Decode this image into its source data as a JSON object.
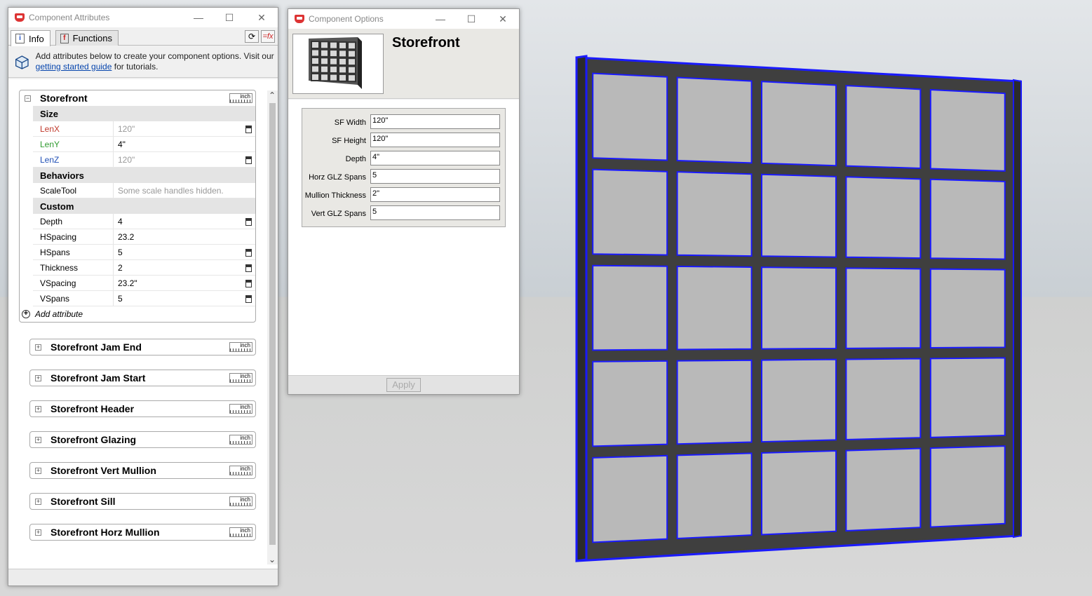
{
  "attrs_window": {
    "title": "Component Attributes",
    "tabs": [
      {
        "label": "Info",
        "active": true
      },
      {
        "label": "Functions",
        "active": false
      }
    ],
    "info_text_1": "Add attributes below to create your component options. Visit our ",
    "info_link": "getting started guide",
    "info_text_2": " for tutorials.",
    "unit_label": "inch",
    "main_group": {
      "name": "Storefront",
      "sections": [
        {
          "title": "Size",
          "rows": [
            {
              "key": "LenX",
              "value": "120\"",
              "key_color": "#c0392b",
              "value_grey": true,
              "calc": true
            },
            {
              "key": "LenY",
              "value": "4\"",
              "key_color": "#2e9a2e",
              "value_grey": false,
              "calc": false
            },
            {
              "key": "LenZ",
              "value": "120\"",
              "key_color": "#1f4fb5",
              "value_grey": true,
              "calc": true
            }
          ]
        },
        {
          "title": "Behaviors",
          "rows": [
            {
              "key": "ScaleTool",
              "value": "Some scale handles hidden.",
              "key_color": "#000000",
              "value_grey": true,
              "calc": false
            }
          ]
        },
        {
          "title": "Custom",
          "rows": [
            {
              "key": "Depth",
              "value": "4",
              "key_color": "#000000",
              "value_grey": false,
              "calc": true
            },
            {
              "key": "HSpacing",
              "value": "23.2",
              "key_color": "#000000",
              "value_grey": false,
              "calc": false
            },
            {
              "key": "HSpans",
              "value": "5",
              "key_color": "#000000",
              "value_grey": false,
              "calc": true
            },
            {
              "key": "Thickness",
              "value": "2",
              "key_color": "#000000",
              "value_grey": false,
              "calc": true
            },
            {
              "key": "VSpacing",
              "value": "23.2\"",
              "key_color": "#000000",
              "value_grey": false,
              "calc": true
            },
            {
              "key": "VSpans",
              "value": "5",
              "key_color": "#000000",
              "value_grey": false,
              "calc": true
            }
          ]
        }
      ],
      "add_attribute": "Add attribute"
    },
    "collapsed_groups": [
      "Storefront Jam End",
      "Storefront Jam Start",
      "Storefront Header",
      "Storefront Glazing",
      "Storefront Vert Mullion",
      "Storefront Sill",
      "Storefront Horz Mullion"
    ]
  },
  "options_window": {
    "title": "Component Options",
    "component_name": "Storefront",
    "fields": [
      {
        "label": "SF Width",
        "value": "120\""
      },
      {
        "label": "SF Height",
        "value": "120\""
      },
      {
        "label": "Depth",
        "value": "4\""
      },
      {
        "label": "Horz GLZ Spans",
        "value": "5"
      },
      {
        "label": "Mullion Thickness",
        "value": "2\""
      },
      {
        "label": "Vert GLZ Spans",
        "value": "5"
      }
    ],
    "apply_label": "Apply"
  },
  "colors": {
    "selection_blue": "#1a1aff",
    "frame_dark": "#3f3f3f",
    "glass": "#b9b9b9"
  }
}
